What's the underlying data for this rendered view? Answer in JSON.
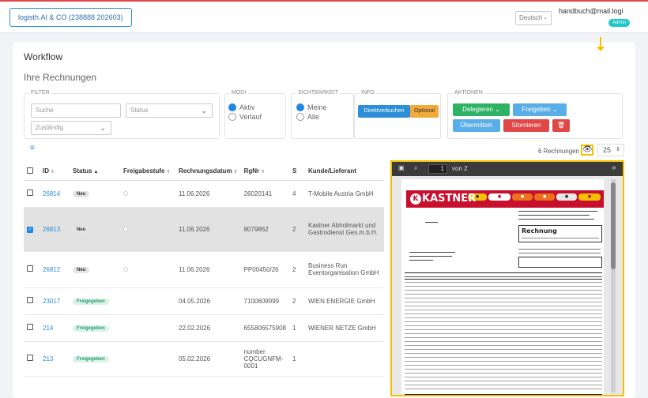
{
  "header": {
    "company_button": "logisth.AI & CO (238888 202603)",
    "language": "Deutsch",
    "user_email": "handbuch@mail.logi",
    "role_badge": "Admin"
  },
  "page": {
    "title": "Workflow",
    "subtitle": "Ihre Rechnungen"
  },
  "filter": {
    "legend": "FILTER",
    "search_placeholder": "Suche",
    "status_placeholder": "Status",
    "zustaendig_placeholder": "Zuständig"
  },
  "modi": {
    "legend": "MODI",
    "options": [
      "Aktiv",
      "Verlauf"
    ]
  },
  "sichtbarkeit": {
    "legend": "SICHTBARKEIT",
    "options": [
      "Meine",
      "Alle"
    ]
  },
  "info": {
    "legend": "INFO",
    "direkt": "Direktverbuchen",
    "optional": "Optional"
  },
  "aktionen": {
    "legend": "AKTIONEN",
    "delegieren": "Delegieren",
    "freigeben": "Freigeben",
    "uebermitteln": "Übermitteln",
    "stornieren": "Stornieren"
  },
  "list_meta": {
    "count_text": "6 Rechnungen",
    "per_page": "25"
  },
  "table": {
    "columns": [
      "ID",
      "Status",
      "Freigabestufe",
      "Rechnungsdatum",
      "RgNr",
      "S",
      "Kunde/Lieferant"
    ],
    "rows": [
      {
        "id": "26814",
        "status": "Neu",
        "date": "11.06.2026",
        "rgnr": "26020141",
        "s": "4",
        "kunde": "T-Mobile Austria GmbH",
        "checked": false
      },
      {
        "id": "26813",
        "status": "Neu",
        "date": "11.06.2026",
        "rgnr": "8079862",
        "s": "2",
        "kunde": "Kastner Abholmarkt und Gastrodienst Ges.m.b.H.",
        "checked": true
      },
      {
        "id": "26812",
        "status": "Neu",
        "date": "11.06.2026",
        "rgnr": "PP00450/26",
        "s": "2",
        "kunde": "Business Run Eventorganisation GmbH",
        "checked": false
      },
      {
        "id": "23017",
        "status": "Freigegeben",
        "date": "04.05.2026",
        "rgnr": "7100609999",
        "s": "2",
        "kunde": "WIEN ENERGIE GmbH",
        "checked": false
      },
      {
        "id": "214",
        "status": "Freigegeben",
        "date": "22.02.2026",
        "rgnr": "655806575908",
        "s": "1",
        "kunde": "WIENER NETZE GmbH",
        "checked": false
      },
      {
        "id": "213",
        "status": "Freigegeben",
        "date": "05.02.2026",
        "rgnr": "number CQCUGNFM-0001",
        "s": "1",
        "kunde": "",
        "checked": false
      }
    ]
  },
  "viewer": {
    "page_input": "1",
    "page_of": "von 2",
    "logo": "KASTNER",
    "doc_title": "Rechnung"
  },
  "colors": {
    "accent": "#1e88e5",
    "highlight": "#f2c200",
    "brand_red": "#c8102e"
  }
}
